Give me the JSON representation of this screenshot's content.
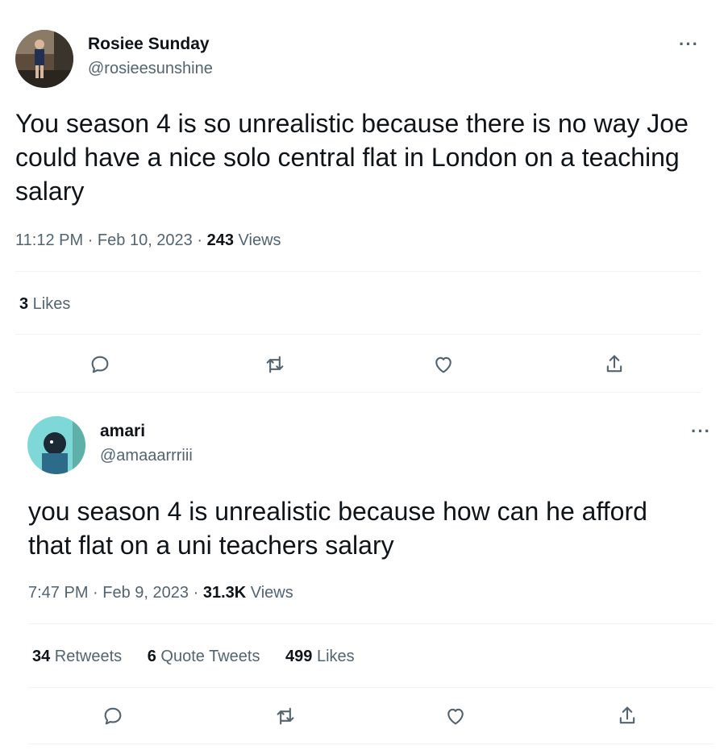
{
  "tweets": [
    {
      "display_name": "Rosiee Sunday",
      "handle": "@rosieesunshine",
      "more": "···",
      "text": "You season 4 is so unrealistic because there is no way Joe could have a nice solo central flat in London on a teaching salary",
      "time": "11:12 PM",
      "sep": "·",
      "date": "Feb 10, 2023",
      "views_count": "243",
      "views_label": " Views",
      "likes_count": "3",
      "likes_label": " Likes",
      "avatar_colors": {
        "bg": "#6b5a48",
        "figure": "#2d3a5c"
      }
    },
    {
      "display_name": "amari",
      "handle": "@amaaarrriii",
      "more": "···",
      "text": "you season 4 is unrealistic because how can he afford that flat on a uni teachers salary",
      "time": "7:47 PM",
      "sep": "·",
      "date": "Feb 9, 2023",
      "views_count": "31.3K",
      "views_label": " Views",
      "retweets_count": "34",
      "retweets_label": " Retweets",
      "quotes_count": "6",
      "quotes_label": " Quote Tweets",
      "likes_count": "499",
      "likes_label": " Likes",
      "avatar_colors": {
        "bg": "#7fd8d8",
        "figure": "#1c2a36"
      }
    }
  ],
  "actions": [
    "reply-icon",
    "retweet-icon",
    "like-icon",
    "share-icon"
  ],
  "colors": {
    "text": "#0f1419",
    "secondary": "#536471",
    "divider": "#eff3f4"
  }
}
